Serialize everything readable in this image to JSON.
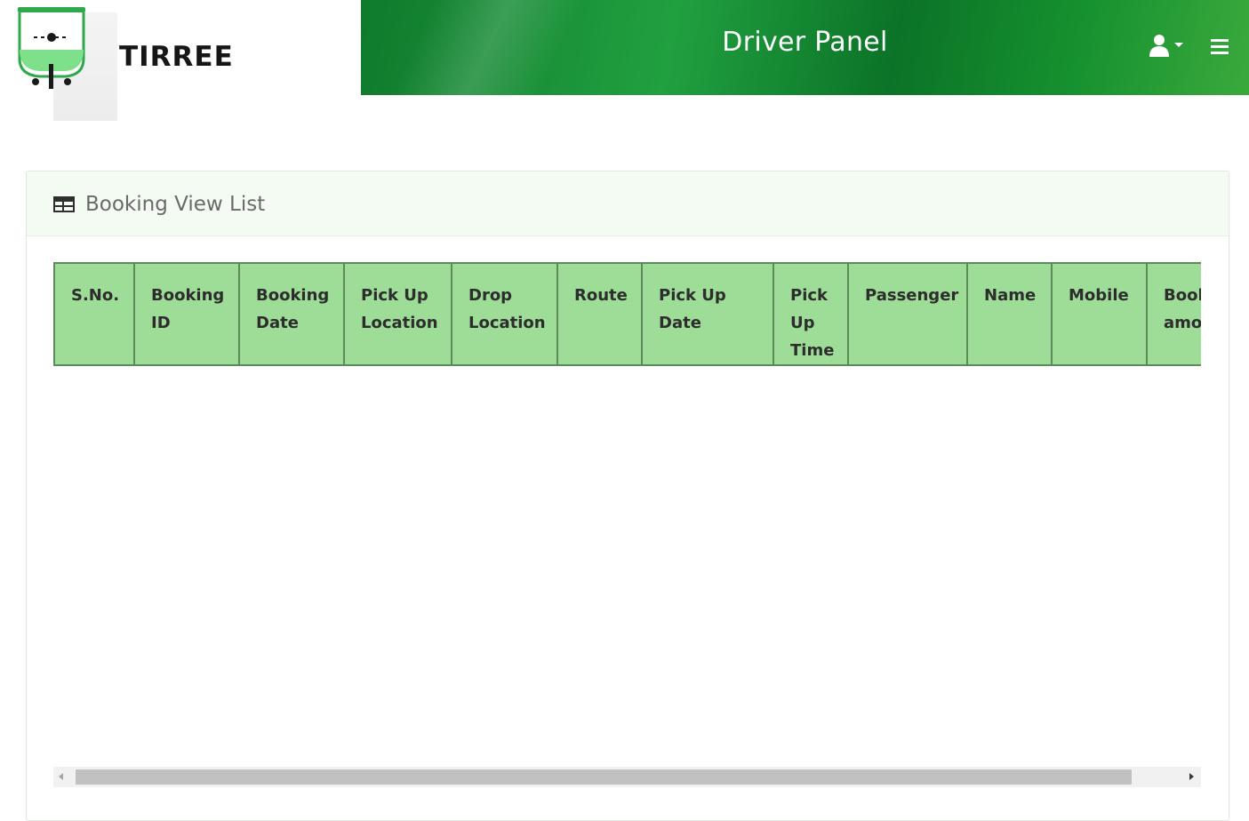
{
  "brand": {
    "name": "TIRREE"
  },
  "header": {
    "title": "Driver Panel",
    "user_icon": "user-icon",
    "menu_icon": "hamburger-icon"
  },
  "colors": {
    "header_green": "#1c9a3a",
    "table_header_bg": "#9ddd97",
    "card_header_bg": "#f4fbf3"
  },
  "card": {
    "title": "Booking View List",
    "icon": "table-icon"
  },
  "table": {
    "columns": [
      "S.No.",
      "Booking ID",
      "Booking Date",
      "Pick Up Location",
      "Drop Location",
      "Route",
      "Pick Up Date",
      "Pick Up Time",
      "Passenger",
      "Name",
      "Mobile",
      "Booking amount"
    ],
    "rows": []
  }
}
